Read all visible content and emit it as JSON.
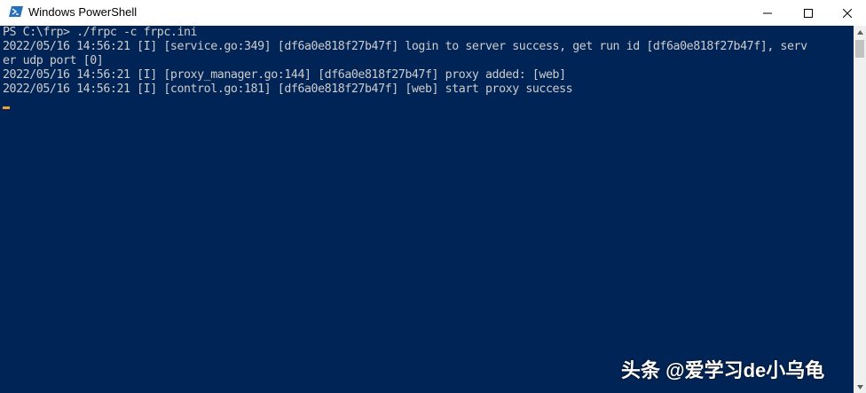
{
  "window": {
    "title": "Windows PowerShell",
    "icon": "powershell-icon",
    "controls": [
      "minimize-icon",
      "maximize-icon",
      "close-icon"
    ]
  },
  "console": {
    "background": "#012456",
    "text_color": "#cccccc",
    "lines": [
      "PS C:\\frp> ./frpc -c frpc.ini",
      "2022/05/16 14:56:21 [I] [service.go:349] [df6a0e818f27b47f] login to server success, get run id [df6a0e818f27b47f], serv",
      "er udp port [0]",
      "2022/05/16 14:56:21 [I] [proxy_manager.go:144] [df6a0e818f27b47f] proxy added: [web]",
      "2022/05/16 14:56:21 [I] [control.go:181] [df6a0e818f27b47f] [web] start proxy success"
    ]
  },
  "watermark": "头条 @爱学习de小乌龟"
}
